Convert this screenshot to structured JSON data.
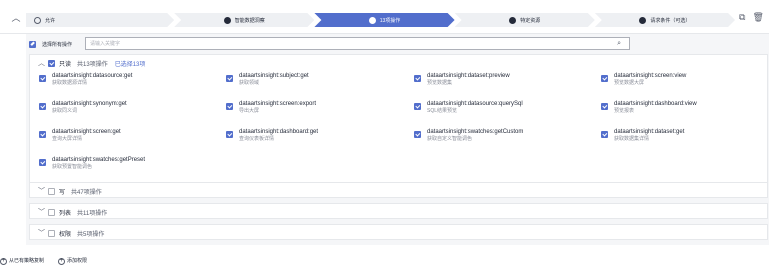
{
  "toolbar": {
    "collapse_icon": "chevron-up-icon",
    "copy_icon": "copy-icon",
    "delete_icon": "trash-icon"
  },
  "steps": [
    {
      "label": "允许",
      "icon": "circle-outline-icon",
      "active": false
    },
    {
      "label": "智能数据洞察",
      "icon": "cloud-service-icon",
      "active": false
    },
    {
      "label": "13项操作",
      "icon": "operation-icon",
      "active": true
    },
    {
      "label": "特定资源",
      "icon": "resource-icon",
      "active": false
    },
    {
      "label": "请求条件（可选）",
      "icon": "condition-icon",
      "active": false
    }
  ],
  "search": {
    "select_all_label": "选择所有操作",
    "placeholder": "请输入关键字",
    "search_icon": "search-icon"
  },
  "groups": {
    "readonly": {
      "name": "只读",
      "count": "共13项操作",
      "selected": "已选择13项",
      "expanded": true
    },
    "write": {
      "name": "写",
      "count": "共47项操作",
      "expanded": false
    },
    "list": {
      "name": "列表",
      "count": "共11项操作",
      "expanded": false
    },
    "permission": {
      "name": "权限",
      "count": "共5项操作",
      "expanded": false
    }
  },
  "actions": [
    {
      "name": "dataartsinsight:datasource:get",
      "desc": "获取数据源详情"
    },
    {
      "name": "dataartsinsight:subject:get",
      "desc": "获取领域"
    },
    {
      "name": "dataartsinsight:dataset:preview",
      "desc": "预览数据集"
    },
    {
      "name": "dataartsinsight:screen:view",
      "desc": "预览数据大屏"
    },
    {
      "name": "dataartsinsight:synonym:get",
      "desc": "获取同义词"
    },
    {
      "name": "dataartsinsight:screen:export",
      "desc": "导出大屏"
    },
    {
      "name": "dataartsinsight:datasource:querySql",
      "desc": "SQL结果预览"
    },
    {
      "name": "dataartsinsight:dashboard:view",
      "desc": "预览报表"
    },
    {
      "name": "dataartsinsight:screen:get",
      "desc": "查询大屏详情"
    },
    {
      "name": "dataartsinsight:dashboard:get",
      "desc": "查询仪表板详情"
    },
    {
      "name": "dataartsinsight:swatches:getCustom",
      "desc": "获取自定义智能调色"
    },
    {
      "name": "dataartsinsight:dataset:get",
      "desc": "获取数据集详情"
    },
    {
      "name": "dataartsinsight:swatches:getPreset",
      "desc": "获取预置智能调色"
    }
  ],
  "footer": {
    "copy_from_policy": "从已有策略复制",
    "add_permission": "添加权限"
  },
  "colors": {
    "accent": "#526ecc",
    "step_bg": "#eef0f3",
    "panel_bg": "#f5f6f8"
  }
}
